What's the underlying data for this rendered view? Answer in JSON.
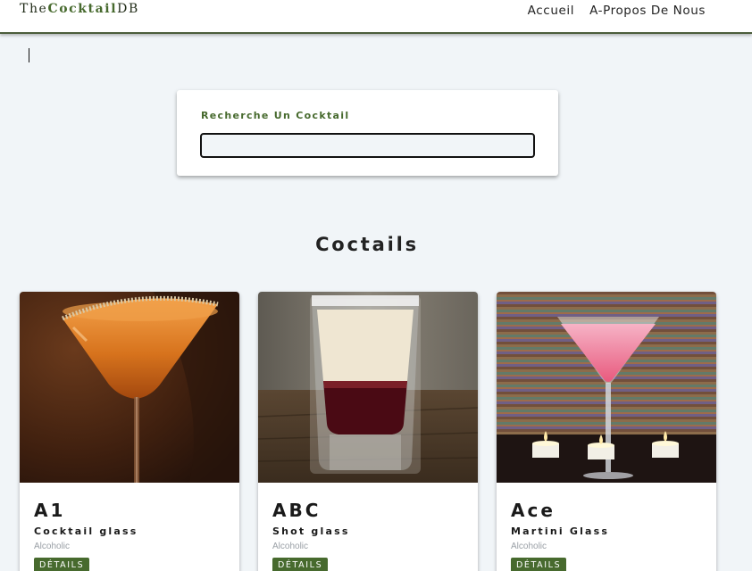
{
  "navbar": {
    "logo_prefix": "The",
    "logo_bold": "Cocktail",
    "logo_suffix": "DB",
    "links": [
      "Accueil",
      "A-Propos De Nous"
    ]
  },
  "search": {
    "label": "Recherche Un Cocktail",
    "value": ""
  },
  "section": {
    "title": "Coctails"
  },
  "cocktails": [
    {
      "name": "A1",
      "glass": "Cocktail glass",
      "info": "Alcoholic",
      "button": "DÉTAILS",
      "image": "a1-cocktail-photo"
    },
    {
      "name": "ABC",
      "glass": "Shot glass",
      "info": "Alcoholic",
      "button": "DÉTAILS",
      "image": "abc-shot-photo"
    },
    {
      "name": "Ace",
      "glass": "Martini Glass",
      "info": "Alcoholic",
      "button": "DÉTAILS",
      "image": "ace-martini-photo"
    }
  ],
  "colors": {
    "primary": "#476a2e",
    "background": "#f1f5f8",
    "navbar_border": "#4b5d3b"
  }
}
